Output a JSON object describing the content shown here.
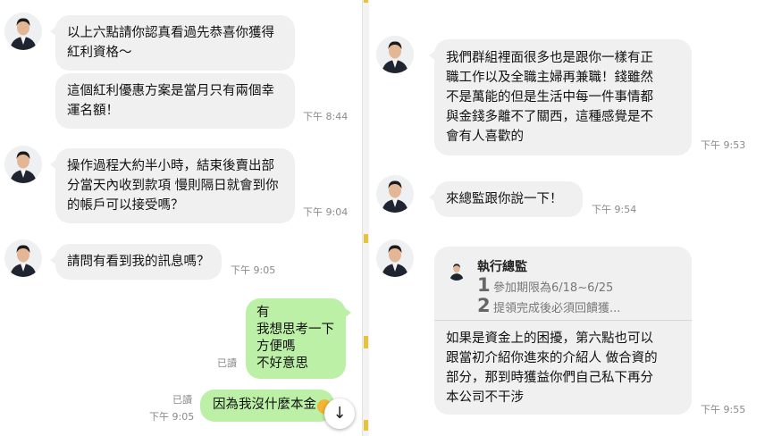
{
  "left": {
    "messages": [
      {
        "text": "以上六點請你認真看過先恭喜你獲得\n紅利資格～"
      },
      {
        "text": "這個紅利優惠方案是當月只有兩個幸\n運名額！",
        "time": "下午 8:44"
      },
      {
        "text": "操作過程大約半小時，結束後賣出部\n分當天內收到款項 慢則隔日就會到你\n的帳戶可以接受嗎？",
        "time": "下午 9:04"
      },
      {
        "text": "請問有看到我的訊息嗎？",
        "time": "下午 9:05"
      },
      {
        "text": "有\n我想思考一下\n方便嗎\n不好意思",
        "read": "已讀"
      },
      {
        "text": "因為我沒什麼本金",
        "read": "已讀",
        "time": "下午 9:05"
      }
    ],
    "scroll_button": "↓"
  },
  "right": {
    "messages": [
      {
        "text": "我們群組裡面很多也是跟你一樣有正\n職工作以及全職主婦再兼職！錢雖然\n不是萬能的但是生活中每一件事情都\n與金錢多離不了關西，這種感覺是不\n會有人喜歡的",
        "time": "下午 9:53"
      },
      {
        "text": "來總監跟你說一下！",
        "time": "下午 9:54"
      }
    ],
    "reply_card": {
      "sender": "執行總監",
      "quote_lines": [
        {
          "num": "1",
          "text": "參加期限為6/18~6/25"
        },
        {
          "num": "2",
          "text": "提領完成後必須回饋獲..."
        }
      ],
      "text": "如果是資金上的困擾，第六點也可以\n跟當初介紹你進來的介紹人 做合資的\n部分，那到時獲益你們自己私下再分\n本公司不干涉",
      "time": "下午 9:55"
    }
  }
}
